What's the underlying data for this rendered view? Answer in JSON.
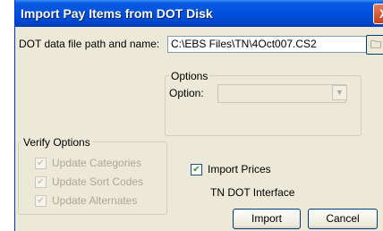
{
  "window": {
    "title": "Import Pay Items from DOT Disk",
    "close_glyph": "X"
  },
  "file": {
    "label": "DOT data file path and name:",
    "value": "C:\\EBS Files\\TN\\4Oct007.CS2",
    "browse_icon": "folder-browse-icon"
  },
  "options": {
    "group_title": "Options",
    "option_label": "Option:",
    "option_value": ""
  },
  "verify": {
    "group_title": "Verify Options",
    "items": [
      {
        "label": "Update Categories",
        "checked": true,
        "enabled": false
      },
      {
        "label": "Update Sort Codes",
        "checked": true,
        "enabled": false
      },
      {
        "label": "Update Alternates",
        "checked": true,
        "enabled": false
      }
    ]
  },
  "import_prices": {
    "label": "Import Prices",
    "checked": true
  },
  "interface_label": "TN DOT Interface",
  "buttons": {
    "import": "Import",
    "cancel": "Cancel"
  }
}
